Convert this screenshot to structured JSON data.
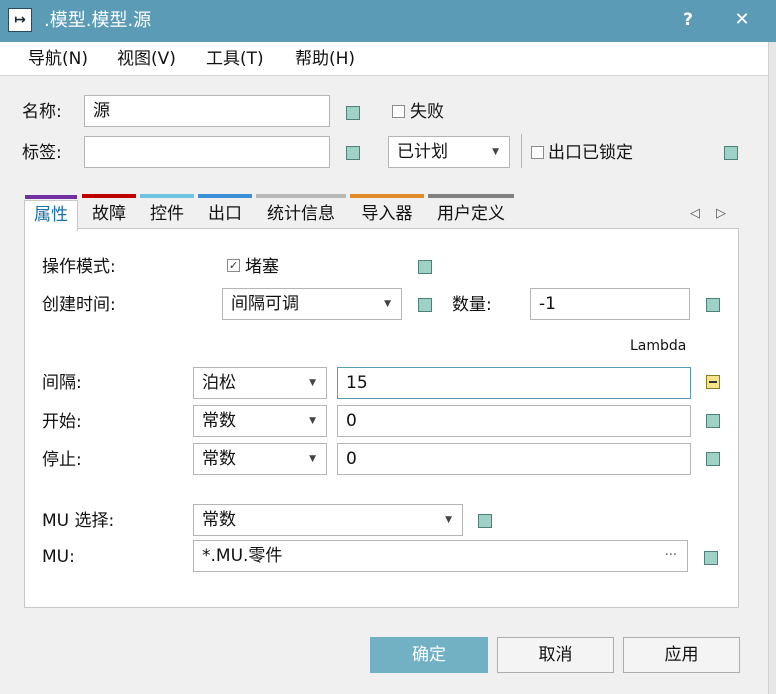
{
  "window": {
    "title": ".模型.模型.源",
    "help": "?",
    "close": "✕",
    "app_icon": "↦"
  },
  "menu": [
    "导航(N)",
    "视图(V)",
    "工具(T)",
    "帮助(H)"
  ],
  "header": {
    "name_label": "名称:",
    "name_value": "源",
    "tag_label": "标签:",
    "tag_value": "",
    "fail_label": "失败",
    "fail_checked": false,
    "plan_value": "已计划",
    "exit_locked_label": "出口已锁定",
    "exit_locked_checked": false
  },
  "tabs": [
    {
      "label": "属性",
      "color": "#7030a0",
      "active": true
    },
    {
      "label": "故障",
      "color": "#c00000"
    },
    {
      "label": "控件",
      "color": "#6fc3e0"
    },
    {
      "label": "出口",
      "color": "#3a8fd6"
    },
    {
      "label": "统计信息",
      "color": "#b8b8b8"
    },
    {
      "label": "导入器",
      "color": "#e08a2a"
    },
    {
      "label": "用户定义",
      "color": "#808080"
    }
  ],
  "tab_scroll": {
    "left": "◁",
    "right": "▷"
  },
  "attributes": {
    "op_mode_label": "操作模式:",
    "block_label": "堵塞",
    "block_checked": true,
    "create_time_label": "创建时间:",
    "create_time_value": "间隔可调",
    "qty_label": "数量:",
    "qty_value": "-1",
    "lambda_label": "Lambda",
    "interval_label": "间隔:",
    "interval_dist": "泊松",
    "interval_value": "15",
    "start_label": "开始:",
    "start_dist": "常数",
    "start_value": "0",
    "stop_label": "停止:",
    "stop_dist": "常数",
    "stop_value": "0",
    "mu_select_label": "MU 选择:",
    "mu_select_value": "常数",
    "mu_label": "MU:",
    "mu_value": "*.MU.零件",
    "mu_browse": "···"
  },
  "buttons": {
    "ok": "确定",
    "cancel": "取消",
    "apply": "应用"
  },
  "colors": {
    "titlebar": "#5b9bb5",
    "ok_button": "#72b0c4",
    "indicator": "#9fd1c6",
    "indicator_highlight": "#f5e48a"
  }
}
